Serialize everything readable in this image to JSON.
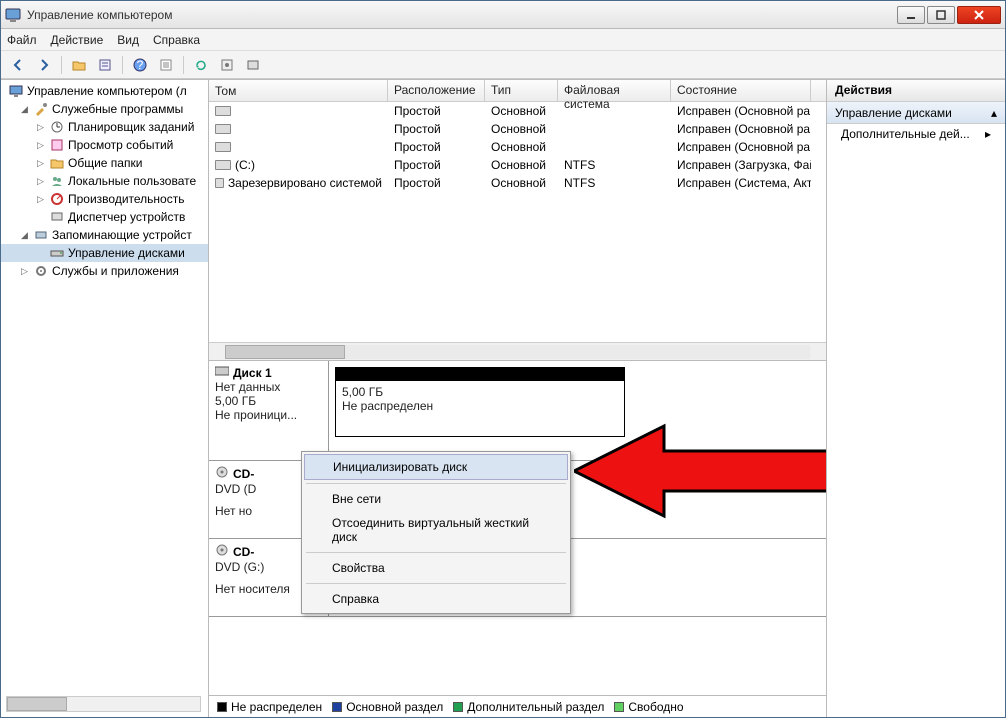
{
  "window": {
    "title": "Управление компьютером"
  },
  "menu": {
    "file": "Файл",
    "action": "Действие",
    "view": "Вид",
    "help": "Справка"
  },
  "tree": {
    "root": "Управление компьютером (л",
    "svc": "Служебные программы",
    "sched": "Планировщик заданий",
    "events": "Просмотр событий",
    "shared": "Общие папки",
    "users": "Локальные пользовате",
    "perf": "Производительность",
    "devmgr": "Диспетчер устройств",
    "storage": "Запоминающие устройст",
    "diskmgmt": "Управление дисками",
    "services": "Службы и приложения"
  },
  "cols": {
    "tom": "Том",
    "ras": "Расположение",
    "tip": "Тип",
    "fs": "Файловая система",
    "state": "Состояние"
  },
  "rows": [
    {
      "tom": "",
      "ras": "Простой",
      "tip": "Основной",
      "fs": "",
      "state": "Исправен (Основной ра"
    },
    {
      "tom": "",
      "ras": "Простой",
      "tip": "Основной",
      "fs": "",
      "state": "Исправен (Основной ра"
    },
    {
      "tom": "",
      "ras": "Простой",
      "tip": "Основной",
      "fs": "",
      "state": "Исправен (Основной ра"
    },
    {
      "tom": "(C:)",
      "ras": "Простой",
      "tip": "Основной",
      "fs": "NTFS",
      "state": "Исправен (Загрузка, Фай"
    },
    {
      "tom": "Зарезервировано системой",
      "ras": "Простой",
      "tip": "Основной",
      "fs": "NTFS",
      "state": "Исправен (Система, Акти"
    }
  ],
  "disk1": {
    "name": "Диск 1",
    "nodata": "Нет данных",
    "size": "5,00 ГБ",
    "notinit": "Не проиници...",
    "part_size": "5,00 ГБ",
    "part_state": "Не распределен"
  },
  "cd0": {
    "name": "CD-",
    "sub": "DVD (D",
    "nomedia": "Нет но"
  },
  "cd1": {
    "name": "CD-",
    "sub": "DVD (G:)",
    "nomedia": "Нет носителя"
  },
  "legend": {
    "unalloc": "Не распределен",
    "primary": "Основной раздел",
    "extended": "Дополнительный раздел",
    "free": "Свободно"
  },
  "actions": {
    "head": "Действия",
    "diskmgmt": "Управление дисками",
    "more": "Дополнительные дей..."
  },
  "ctx": {
    "init": "Инициализировать диск",
    "offline": "Вне сети",
    "detach": "Отсоединить виртуальный жесткий диск",
    "props": "Свойства",
    "help": "Справка"
  }
}
